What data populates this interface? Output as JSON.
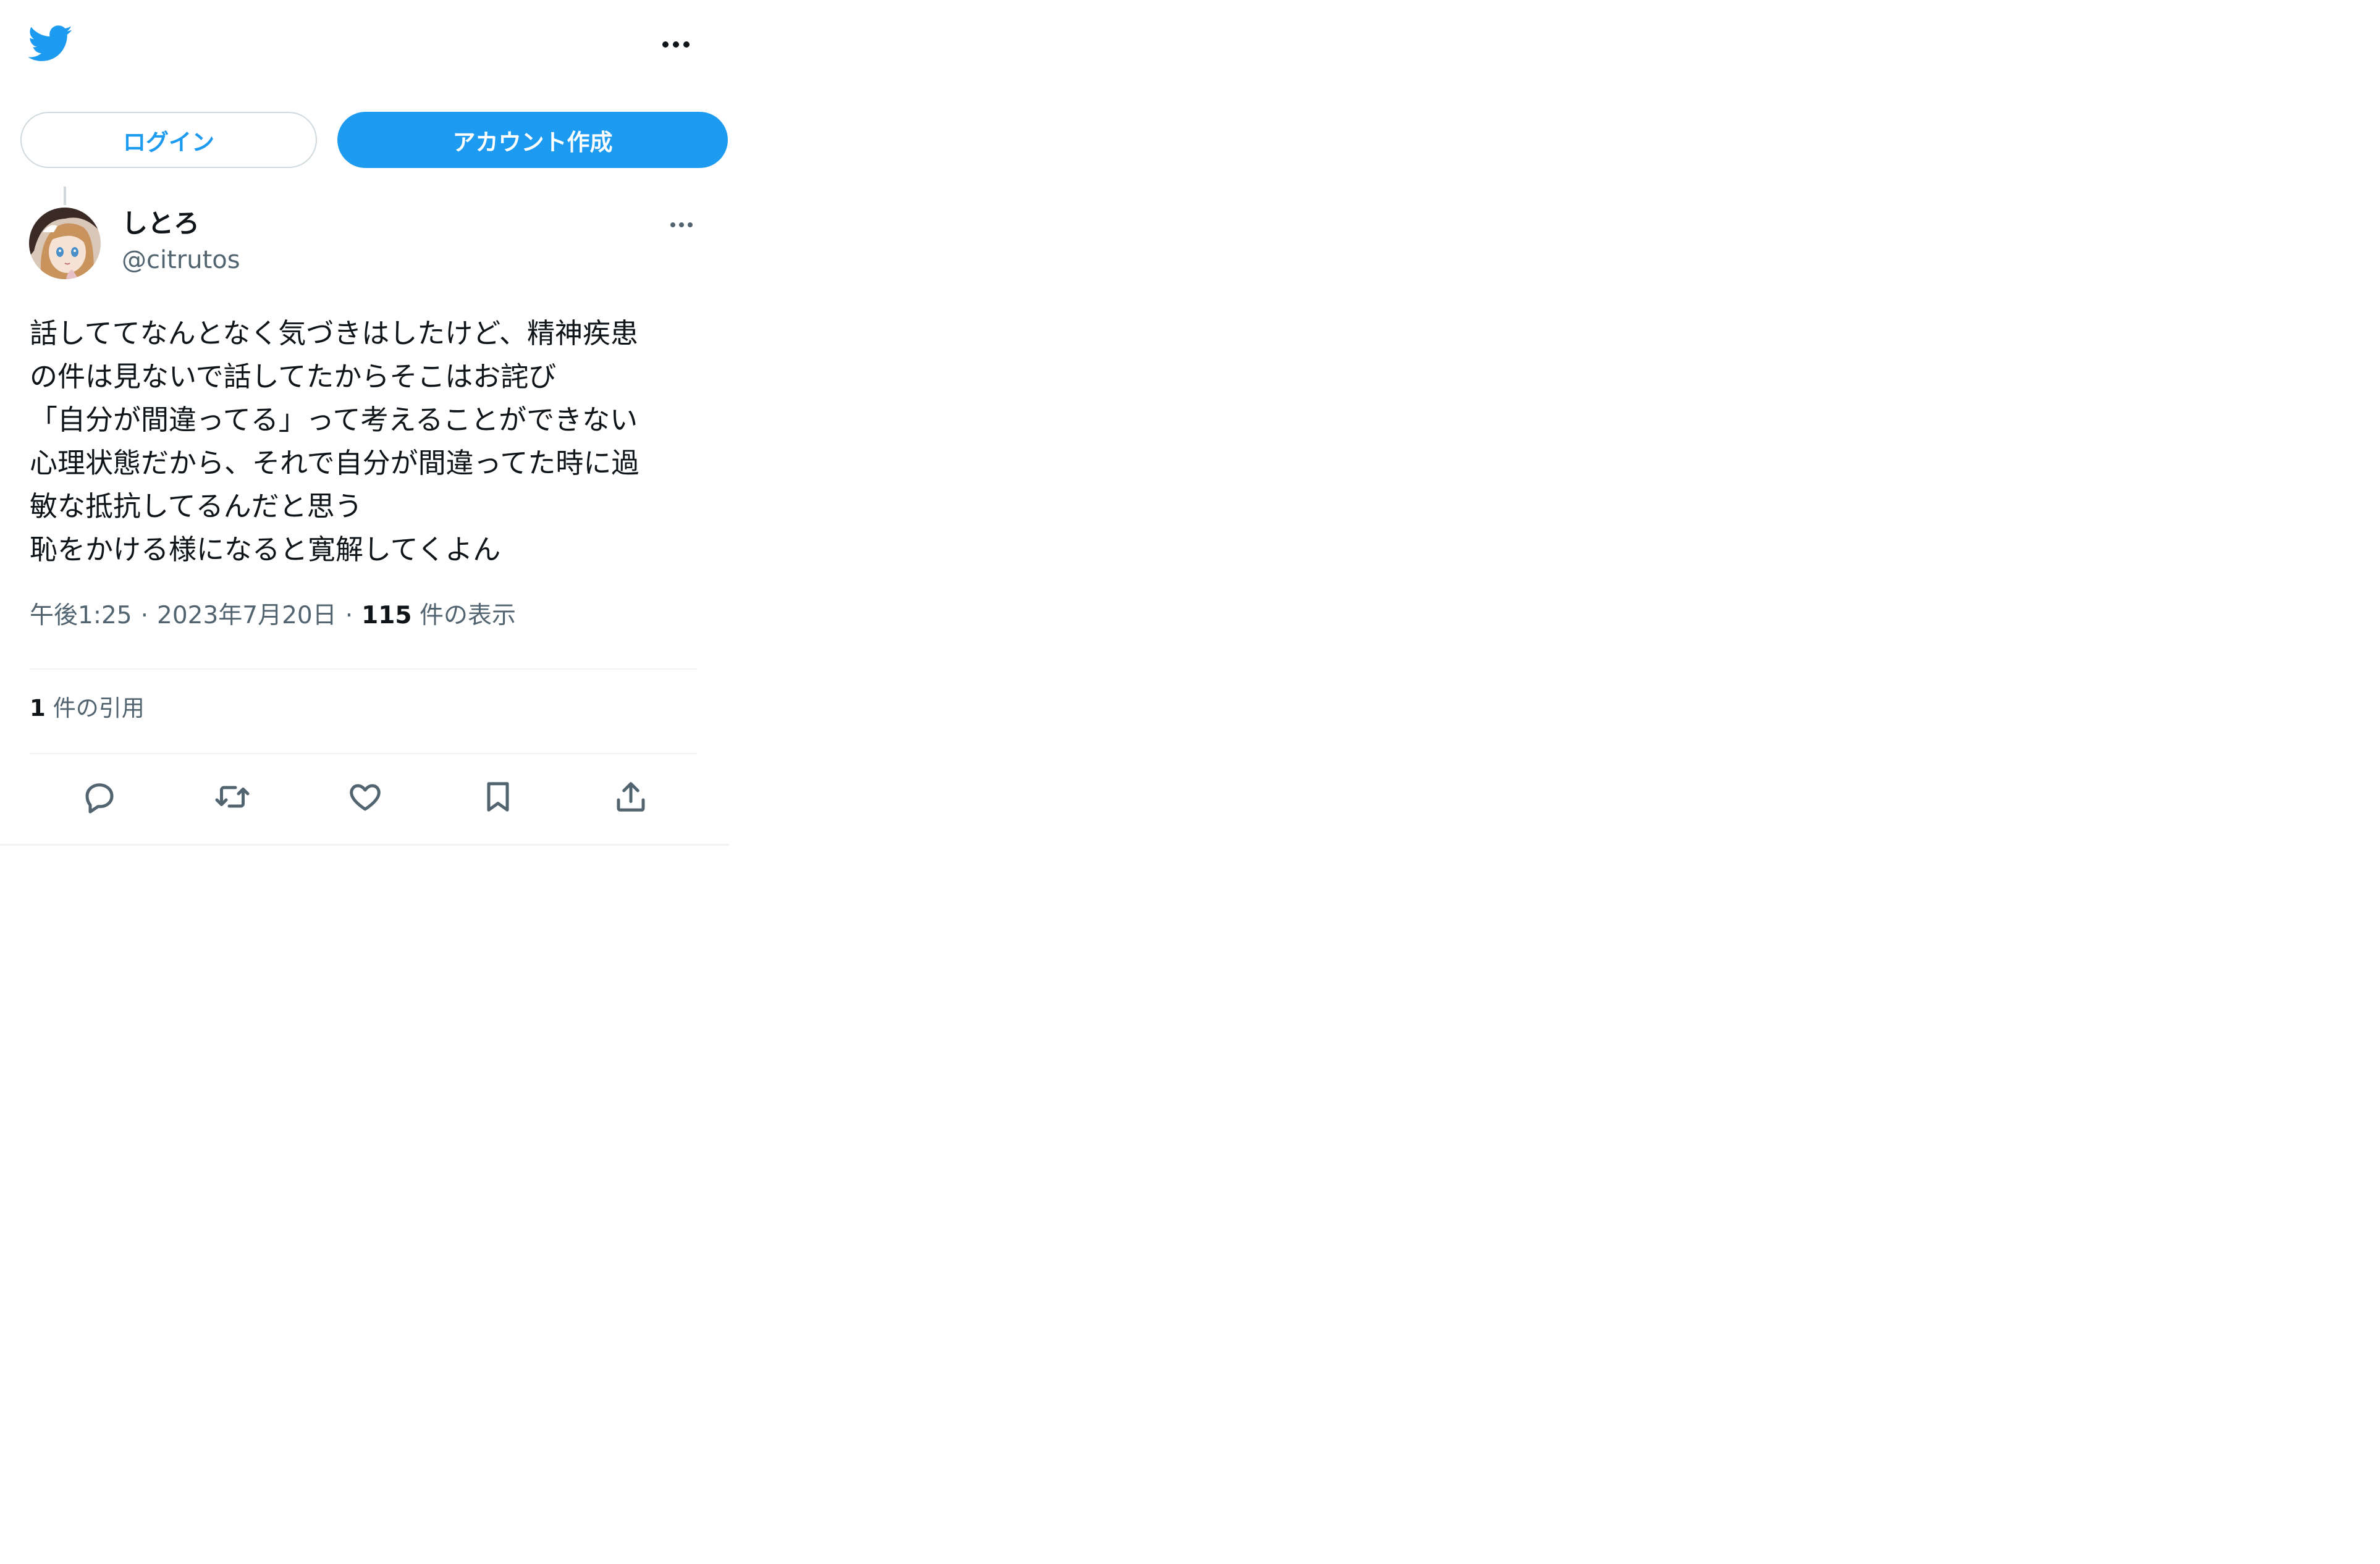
{
  "header": {
    "logo_icon": "twitter-bird-icon",
    "more_icon": "more-horizontal-icon"
  },
  "auth": {
    "login_label": "ログイン",
    "signup_label": "アカウント作成"
  },
  "tweet": {
    "author": {
      "display_name": "しとろ",
      "handle": "@citrutos",
      "avatar_icon": "avatar-image"
    },
    "lines": [
      "話しててなんとなく気づきはしたけど、精神疾患",
      "の件は見ないで話してたからそこはお詫び",
      "「自分が間違ってる」って考えることができない",
      "心理状態だから、それで自分が間違ってた時に過",
      "敏な抵抗してるんだと思う",
      "恥をかける様になると寛解してくよん"
    ],
    "time": "午後1:25",
    "date": "2023年7月20日",
    "separator": "·",
    "views_count": "115",
    "views_label": "件の表示",
    "quotes_count": "1",
    "quotes_label": "件の引用"
  },
  "actions": [
    {
      "name": "reply-icon"
    },
    {
      "name": "retweet-icon"
    },
    {
      "name": "like-icon"
    },
    {
      "name": "bookmark-icon"
    },
    {
      "name": "share-icon"
    }
  ],
  "colors": {
    "brand": "#1d9bf0",
    "text": "#0f1419",
    "secondary": "#536471",
    "border": "#cfd9de",
    "divider": "#eff3f4"
  }
}
